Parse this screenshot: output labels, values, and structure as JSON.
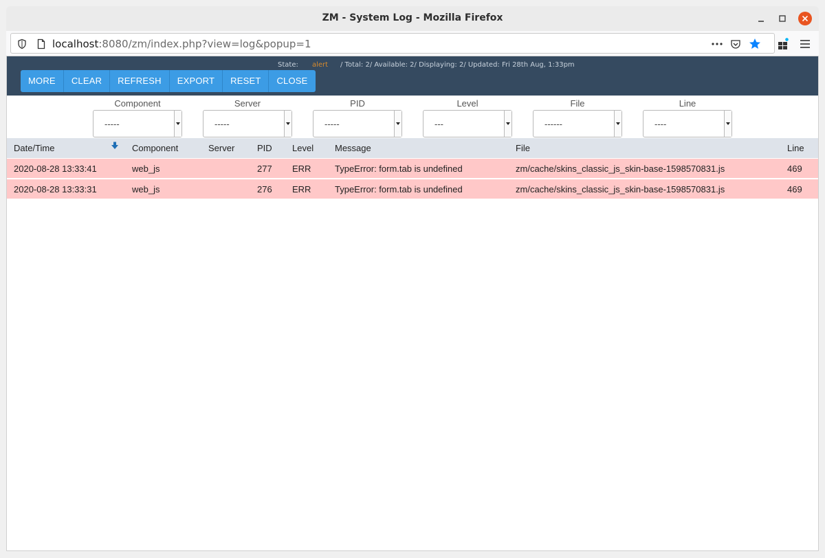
{
  "window": {
    "title": "ZM - System Log - Mozilla Firefox"
  },
  "browser": {
    "url_host": "localhost",
    "url_rest": ":8080/zm/index.php?view=log&popup=1"
  },
  "status": {
    "state_label": "State:",
    "state_value": "alert",
    "summary": "/ Total: 2/ Available: 2/ Displaying: 2/ Updated: Fri 28th Aug, 1:33pm"
  },
  "toolbar": {
    "more_label": "MORE",
    "clear_label": "CLEAR",
    "refresh_label": "REFRESH",
    "export_label": "EXPORT",
    "reset_label": "RESET",
    "close_label": "CLOSE"
  },
  "filters": [
    {
      "label": "Component",
      "value": "-----"
    },
    {
      "label": "Server",
      "value": "-----"
    },
    {
      "label": "PID",
      "value": "-----"
    },
    {
      "label": "Level",
      "value": "---"
    },
    {
      "label": "File",
      "value": "------"
    },
    {
      "label": "Line",
      "value": "----"
    }
  ],
  "table": {
    "columns": [
      "Date/Time",
      "Component",
      "Server",
      "PID",
      "Level",
      "Message",
      "File",
      "Line"
    ],
    "rows": [
      {
        "datetime": "2020-08-28 13:33:41",
        "component": "web_js",
        "server": "",
        "pid": "277",
        "level": "ERR",
        "message": "TypeError: form.tab is undefined",
        "file": "zm/cache/skins_classic_js_skin-base-1598570831.js",
        "line": "469"
      },
      {
        "datetime": "2020-08-28 13:33:31",
        "component": "web_js",
        "server": "",
        "pid": "276",
        "level": "ERR",
        "message": "TypeError: form.tab is undefined",
        "file": "zm/cache/skins_classic_js_skin-base-1598570831.js",
        "line": "469"
      }
    ]
  },
  "colors": {
    "header_bg": "#354a60",
    "button_bg": "#3c9ce5",
    "error_row_bg": "#ffc8c8",
    "state_alert": "#d68a2d",
    "close_button": "#e95420"
  }
}
